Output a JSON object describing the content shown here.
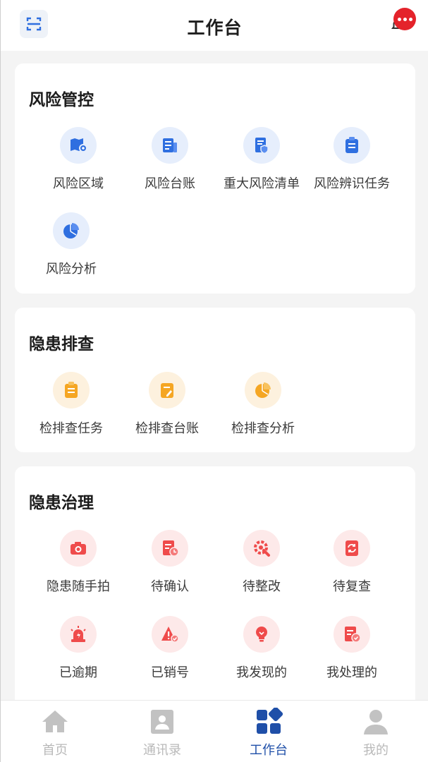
{
  "header": {
    "title": "工作台",
    "scan_icon": "scan-icon",
    "bell_icon": "bell-icon",
    "message_icon": "more-dots-icon",
    "badge_color": "#e4232b"
  },
  "risk_control": {
    "title": "风险管控",
    "accent": "#2f6fe0",
    "items": [
      {
        "label": "风险区域",
        "icon": "map-pin-icon"
      },
      {
        "label": "风险台账",
        "icon": "ledger-icon"
      },
      {
        "label": "重大风险清单",
        "icon": "shield-doc-icon"
      },
      {
        "label": "风险辨识任务",
        "icon": "clipboard-icon"
      },
      {
        "label": "风险分析",
        "icon": "pie-chart-icon"
      }
    ]
  },
  "hazard_check": {
    "title": "隐患排查",
    "accent": "#f5a623",
    "items": [
      {
        "label": "检排查任务",
        "icon": "clipboard-icon"
      },
      {
        "label": "检排查台账",
        "icon": "edit-doc-icon"
      },
      {
        "label": "检排查分析",
        "icon": "pie-chart-icon"
      }
    ]
  },
  "hazard_govern": {
    "title": "隐患治理",
    "accent": "#ef4b4b",
    "items": [
      {
        "label": "隐患随手拍",
        "icon": "camera-icon"
      },
      {
        "label": "待确认",
        "icon": "doc-clock-icon"
      },
      {
        "label": "待整改",
        "icon": "gear-wrench-icon"
      },
      {
        "label": "待复查",
        "icon": "refresh-doc-icon"
      },
      {
        "label": "已逾期",
        "icon": "alarm-light-icon"
      },
      {
        "label": "已销号",
        "icon": "warning-triangle-icon"
      },
      {
        "label": "我发现的",
        "icon": "bulb-icon"
      },
      {
        "label": "我处理的",
        "icon": "doc-check-icon"
      }
    ]
  },
  "bottom_nav": {
    "items": [
      {
        "label": "首页",
        "icon": "home-icon"
      },
      {
        "label": "通讯录",
        "icon": "contacts-icon"
      },
      {
        "label": "工作台",
        "icon": "workbench-icon",
        "active": true
      },
      {
        "label": "我的",
        "icon": "user-icon"
      }
    ],
    "active_color": "#1f4fa8",
    "inactive_color": "#b9b9b9"
  }
}
